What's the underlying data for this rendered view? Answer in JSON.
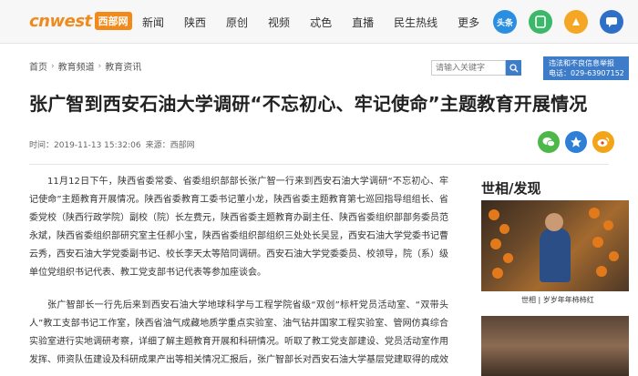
{
  "site": {
    "logo_en": "cnwest",
    "logo_cn": "西部网"
  },
  "nav": [
    "新闻",
    "陕西",
    "原创",
    "视频",
    "忒色",
    "直播",
    "民生热线",
    "更多"
  ],
  "app_icons": [
    {
      "name": "toutiao-icon",
      "label": "头条",
      "color": "#2a8fe0"
    },
    {
      "name": "app-icon",
      "label": "",
      "color": "#3bb86a"
    },
    {
      "name": "weibo-app-icon",
      "label": "",
      "color": "#f5a623"
    },
    {
      "name": "chat-app-icon",
      "label": "",
      "color": "#2e6fc8"
    }
  ],
  "breadcrumb": [
    "首页",
    "教育频道",
    "教育资讯"
  ],
  "search": {
    "placeholder": "请输入关键字"
  },
  "hotline": {
    "line1": "违法和不良信息举报",
    "line2": "电话：029-63907152"
  },
  "article": {
    "title": "张广智到西安石油大学调研“不忘初心、牢记使命”主题教育开展情况",
    "time": "时间：2019-11-13 15:32:06",
    "source": "来源：西部网",
    "paragraphs": [
      "11月12日下午，陕西省委常委、省委组织部部长张广智一行来到西安石油大学调研“不忘初心、牢记使命”主题教育开展情况。陕西省委教育工委书记董小龙，陕西省委主题教育第七巡回指导组组长、省委党校（陕西行政学院）副校（院）长左费元，陕西省委主题教育办副主任、陕西省委组织部部务委员范永斌，陕西省委组织部研究室主任郝小宝，陕西省委组织部组织三处处长吴昱，西安石油大学党委书记曹云秀，西安石油大学党委副书记、校长李天太等陪同调研。西安石油大学党委委员、校领导，院（系）级单位党组织书记代表、教工党支部书记代表等参加座谈会。",
      "张广智部长一行先后来到西安石油大学地球科学与工程学院省级“双创”标杆党员活动室、“双带头人”教工支部书记工作室，陕西省油气成藏地质学重点实验室、油气钻井国家工程实验室、管网仿真综合实验室进行实地调研考察，详细了解主题教育开展和科研情况。听取了教工党支部建设、党员活动室作用发挥、师资队伍建设及科研成果产出等相关情况汇报后，张广智部长对西安石油大学基层党建取得的成效"
    ]
  },
  "sidebar": {
    "title": "世相/发现",
    "caption": "世相 | 岁岁年年柿柿红"
  }
}
